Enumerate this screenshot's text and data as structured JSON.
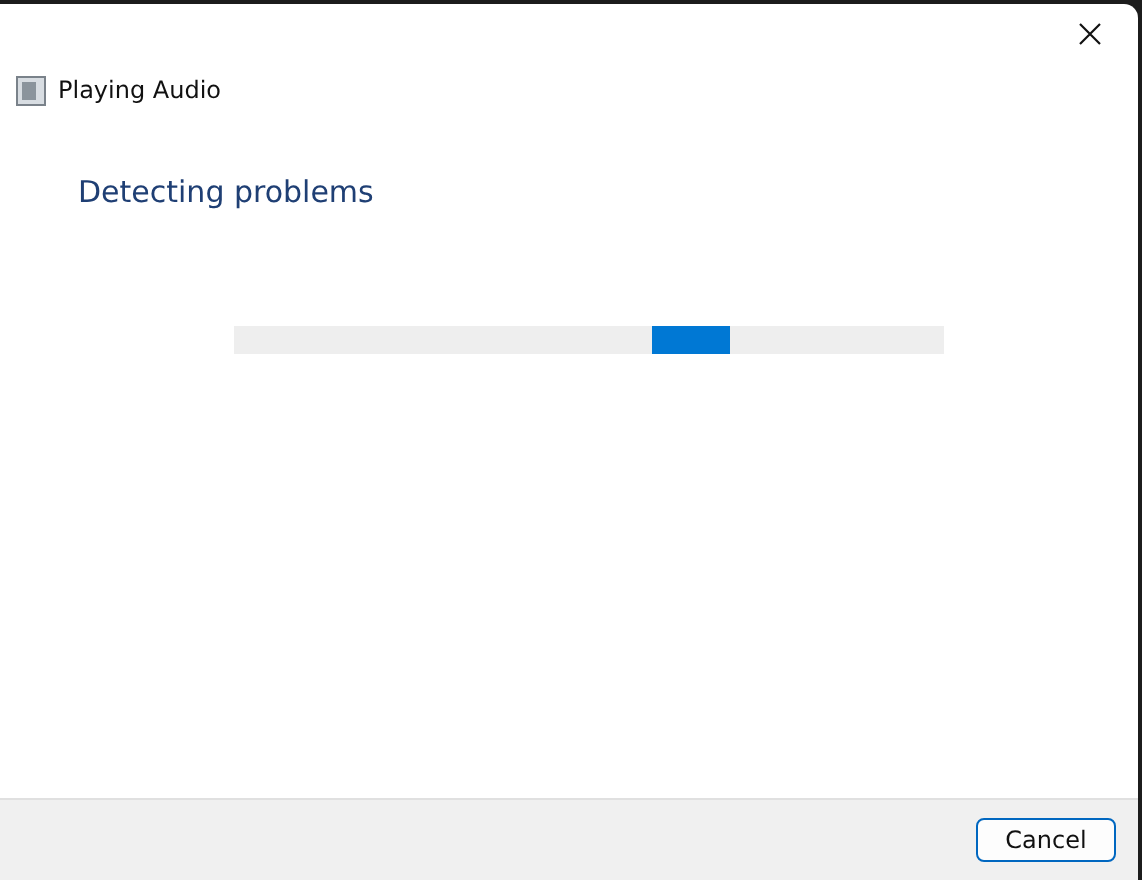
{
  "window": {
    "title": "Playing Audio"
  },
  "heading": "Detecting problems",
  "progress": {
    "kind": "indeterminate",
    "level": 0.59
  },
  "buttons": [
    {
      "label": "Cancel"
    }
  ]
}
